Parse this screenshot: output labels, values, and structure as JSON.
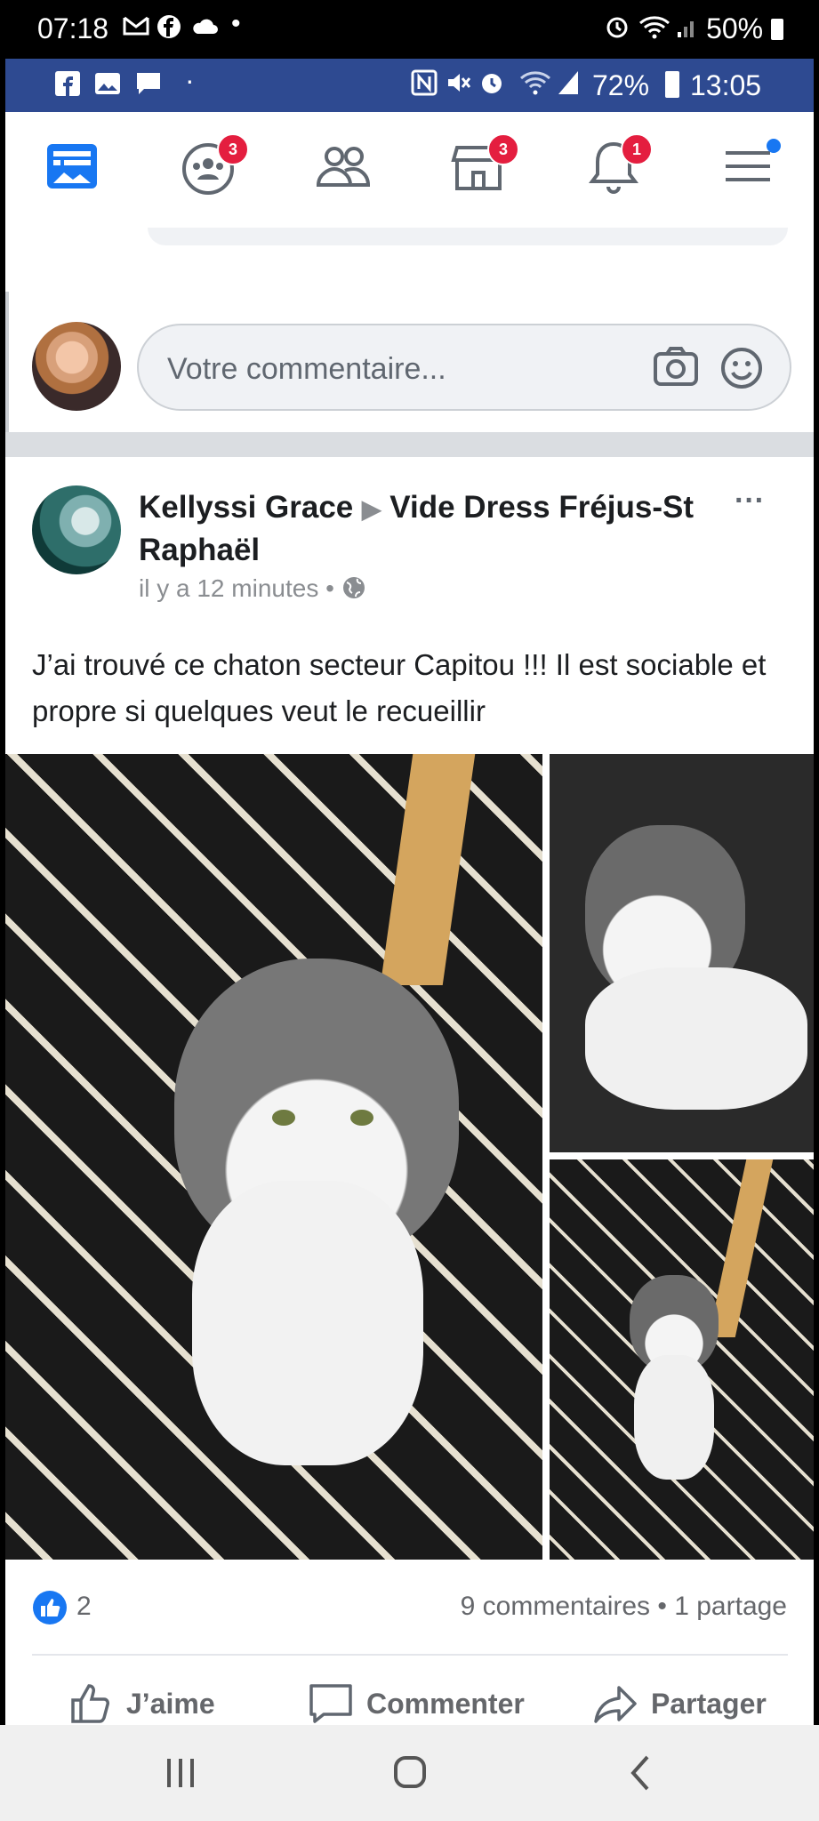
{
  "outer_status": {
    "time": "07:18",
    "battery": "50%"
  },
  "inner_status": {
    "battery": "72%",
    "time": "13:05"
  },
  "nav": {
    "groups_badge": "3",
    "marketplace_badge": "3",
    "notifications_badge": "1"
  },
  "comment": {
    "placeholder": "Votre commentaire..."
  },
  "post": {
    "author": "Kellyssi Grace",
    "group": "Vide Dress Fréjus-St Raphaël",
    "time": "il y a 12 minutes",
    "text": "J’ai trouvé ce chaton secteur Capitou  !!! Il est sociable et propre si quelques veut le recueillir",
    "likes_count": "2",
    "comments_shares": "9 commentaires • 1 partage",
    "more": "···"
  },
  "actions": {
    "like": "J’aime",
    "comment": "Commenter",
    "share": "Partager"
  },
  "colors": {
    "fb_blue": "#1877f2",
    "inner_status_bg": "#2e4a91",
    "badge_red": "#e41e3f"
  }
}
